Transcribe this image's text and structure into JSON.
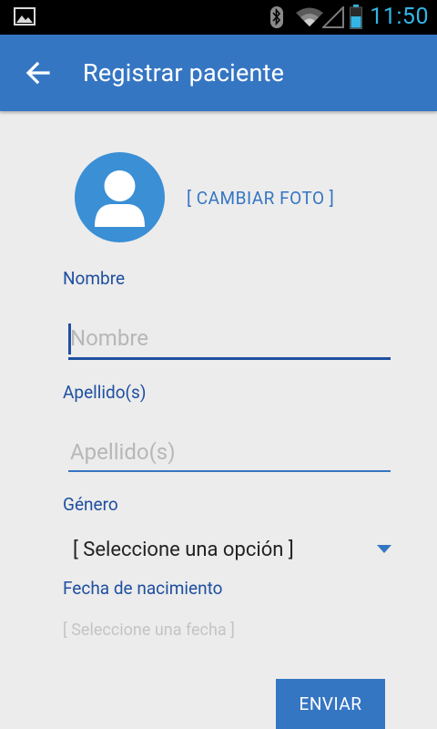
{
  "status_bar": {
    "time": "11:50",
    "icons": [
      "gallery-icon",
      "bluetooth-icon",
      "wifi-icon",
      "signal-icon",
      "battery-icon"
    ],
    "accent_color": "#33b5e5"
  },
  "app_bar": {
    "title": "Registrar paciente",
    "back_icon": "arrow-left-icon",
    "color": "#3576c3"
  },
  "profile": {
    "avatar_icon": "person-icon",
    "change_photo_label": "[ CAMBIAR FOTO ]"
  },
  "form": {
    "nombre": {
      "label": "Nombre",
      "placeholder": "Nombre",
      "value": ""
    },
    "apellido": {
      "label": "Apellido(s)",
      "placeholder": "Apellido(s)",
      "value": ""
    },
    "genero": {
      "label": "Género",
      "selected": "[ Seleccione una opción ]"
    },
    "fecha": {
      "label": "Fecha de nacimiento",
      "placeholder": "[ Seleccione una fecha ]"
    },
    "submit_label": "ENVIAR"
  }
}
